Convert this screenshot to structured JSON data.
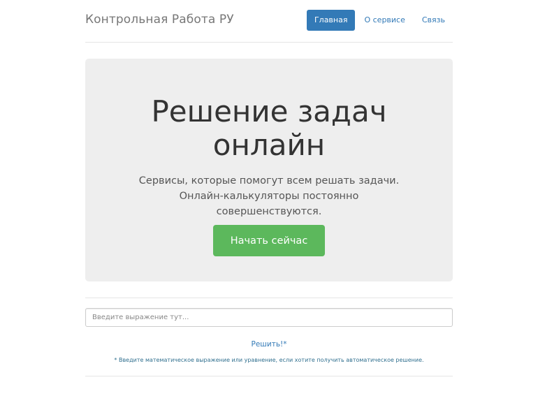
{
  "header": {
    "brand": "Контрольная Работа РУ",
    "nav": [
      {
        "label": "Главная",
        "active": true
      },
      {
        "label": "О сервисе",
        "active": false
      },
      {
        "label": "Связь",
        "active": false
      }
    ]
  },
  "jumbotron": {
    "heading_line1": "Решение задач",
    "heading_line2": "онлайн",
    "lead_line1": "Сервисы, которые помогут всем решать задачи.",
    "lead_line2": "Онлайн-калькуляторы постоянно",
    "lead_line3": "совершенствуются.",
    "button_label": "Начать сейчас"
  },
  "solver": {
    "input_placeholder": "Введите выражение тут...",
    "solve_label": "Решить!*",
    "hint": "* Введите математическое выражение или уравнение, если хотите получить автоматическое решение."
  },
  "colors": {
    "primary": "#337ab7",
    "success": "#5cb85c",
    "jumbotron_bg": "#eeeeee",
    "hint": "#31708f"
  }
}
